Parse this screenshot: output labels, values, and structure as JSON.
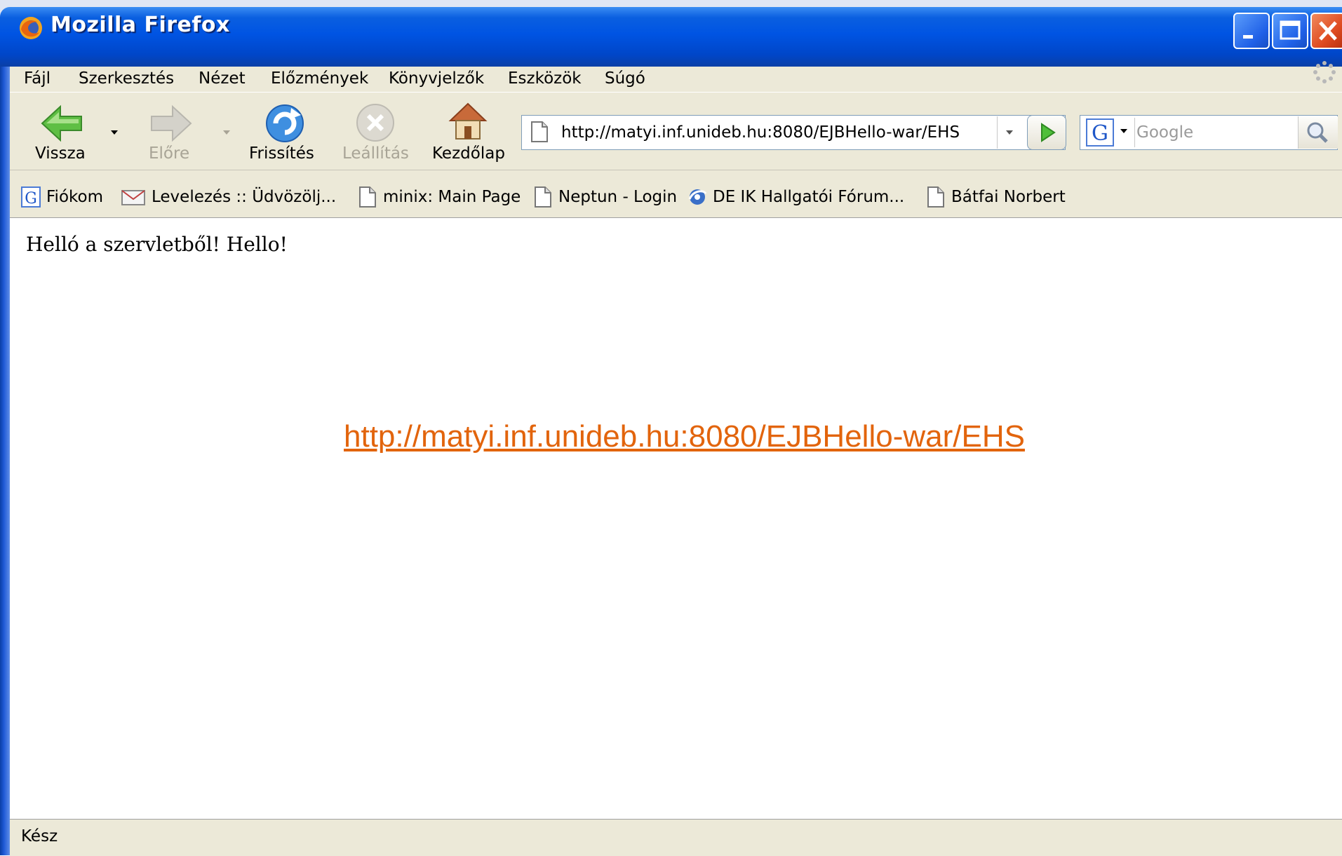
{
  "window": {
    "title": "Mozilla Firefox"
  },
  "menubar": {
    "items": [
      {
        "label": "Fájl"
      },
      {
        "label": "Szerkesztés"
      },
      {
        "label": "Nézet"
      },
      {
        "label": "Előzmények"
      },
      {
        "label": "Könyvjelzők"
      },
      {
        "label": "Eszközök"
      },
      {
        "label": "Súgó"
      }
    ]
  },
  "navbar": {
    "back_label": "Vissza",
    "forward_label": "Előre",
    "reload_label": "Frissítés",
    "stop_label": "Leállítás",
    "home_label": "Kezdőlap",
    "url": "http://matyi.inf.unideb.hu:8080/EJBHello-war/EHS",
    "search_placeholder": "Google"
  },
  "bookmarks": [
    {
      "label": "Fiókom",
      "icon": "google-icon"
    },
    {
      "label": "Levelezés :: Üdvözölj...",
      "icon": "mail-icon"
    },
    {
      "label": "minix: Main Page",
      "icon": "page-icon"
    },
    {
      "label": "Neptun - Login",
      "icon": "page-icon"
    },
    {
      "label": "DE IK Hallgatói Fórum...",
      "icon": "forum-icon"
    },
    {
      "label": "Bátfai Norbert",
      "icon": "page-icon"
    }
  ],
  "content": {
    "text": "Helló a szervletből! Hello!",
    "link": "http://matyi.inf.unideb.hu:8080/EJBHello-war/EHS",
    "link_color": "#e2640c"
  },
  "status": {
    "text": "Kész"
  }
}
